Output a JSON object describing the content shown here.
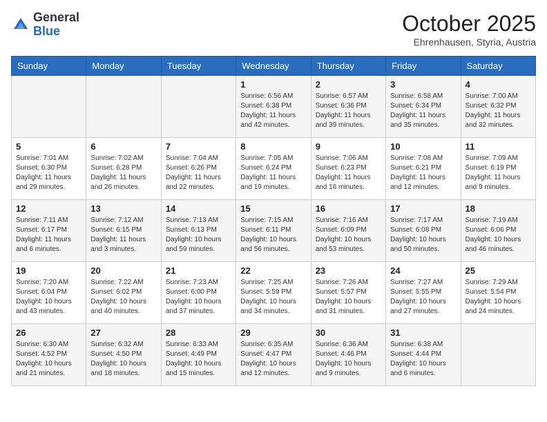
{
  "header": {
    "logo": {
      "general": "General",
      "blue": "Blue"
    },
    "title": "October 2025",
    "location": "Ehrenhausen, Styria, Austria"
  },
  "calendar": {
    "days_of_week": [
      "Sunday",
      "Monday",
      "Tuesday",
      "Wednesday",
      "Thursday",
      "Friday",
      "Saturday"
    ],
    "weeks": [
      [
        {
          "day": "",
          "info": ""
        },
        {
          "day": "",
          "info": ""
        },
        {
          "day": "",
          "info": ""
        },
        {
          "day": "1",
          "info": "Sunrise: 6:56 AM\nSunset: 6:38 PM\nDaylight: 11 hours\nand 42 minutes."
        },
        {
          "day": "2",
          "info": "Sunrise: 6:57 AM\nSunset: 6:36 PM\nDaylight: 11 hours\nand 39 minutes."
        },
        {
          "day": "3",
          "info": "Sunrise: 6:58 AM\nSunset: 6:34 PM\nDaylight: 11 hours\nand 35 minutes."
        },
        {
          "day": "4",
          "info": "Sunrise: 7:00 AM\nSunset: 6:32 PM\nDaylight: 11 hours\nand 32 minutes."
        }
      ],
      [
        {
          "day": "5",
          "info": "Sunrise: 7:01 AM\nSunset: 6:30 PM\nDaylight: 11 hours\nand 29 minutes."
        },
        {
          "day": "6",
          "info": "Sunrise: 7:02 AM\nSunset: 6:28 PM\nDaylight: 11 hours\nand 26 minutes."
        },
        {
          "day": "7",
          "info": "Sunrise: 7:04 AM\nSunset: 6:26 PM\nDaylight: 11 hours\nand 22 minutes."
        },
        {
          "day": "8",
          "info": "Sunrise: 7:05 AM\nSunset: 6:24 PM\nDaylight: 11 hours\nand 19 minutes."
        },
        {
          "day": "9",
          "info": "Sunrise: 7:06 AM\nSunset: 6:23 PM\nDaylight: 11 hours\nand 16 minutes."
        },
        {
          "day": "10",
          "info": "Sunrise: 7:08 AM\nSunset: 6:21 PM\nDaylight: 11 hours\nand 12 minutes."
        },
        {
          "day": "11",
          "info": "Sunrise: 7:09 AM\nSunset: 6:19 PM\nDaylight: 11 hours\nand 9 minutes."
        }
      ],
      [
        {
          "day": "12",
          "info": "Sunrise: 7:11 AM\nSunset: 6:17 PM\nDaylight: 11 hours\nand 6 minutes."
        },
        {
          "day": "13",
          "info": "Sunrise: 7:12 AM\nSunset: 6:15 PM\nDaylight: 11 hours\nand 3 minutes."
        },
        {
          "day": "14",
          "info": "Sunrise: 7:13 AM\nSunset: 6:13 PM\nDaylight: 10 hours\nand 59 minutes."
        },
        {
          "day": "15",
          "info": "Sunrise: 7:15 AM\nSunset: 6:11 PM\nDaylight: 10 hours\nand 56 minutes."
        },
        {
          "day": "16",
          "info": "Sunrise: 7:16 AM\nSunset: 6:09 PM\nDaylight: 10 hours\nand 53 minutes."
        },
        {
          "day": "17",
          "info": "Sunrise: 7:17 AM\nSunset: 6:08 PM\nDaylight: 10 hours\nand 50 minutes."
        },
        {
          "day": "18",
          "info": "Sunrise: 7:19 AM\nSunset: 6:06 PM\nDaylight: 10 hours\nand 46 minutes."
        }
      ],
      [
        {
          "day": "19",
          "info": "Sunrise: 7:20 AM\nSunset: 6:04 PM\nDaylight: 10 hours\nand 43 minutes."
        },
        {
          "day": "20",
          "info": "Sunrise: 7:22 AM\nSunset: 6:02 PM\nDaylight: 10 hours\nand 40 minutes."
        },
        {
          "day": "21",
          "info": "Sunrise: 7:23 AM\nSunset: 6:00 PM\nDaylight: 10 hours\nand 37 minutes."
        },
        {
          "day": "22",
          "info": "Sunrise: 7:25 AM\nSunset: 5:59 PM\nDaylight: 10 hours\nand 34 minutes."
        },
        {
          "day": "23",
          "info": "Sunrise: 7:26 AM\nSunset: 5:57 PM\nDaylight: 10 hours\nand 31 minutes."
        },
        {
          "day": "24",
          "info": "Sunrise: 7:27 AM\nSunset: 5:55 PM\nDaylight: 10 hours\nand 27 minutes."
        },
        {
          "day": "25",
          "info": "Sunrise: 7:29 AM\nSunset: 5:54 PM\nDaylight: 10 hours\nand 24 minutes."
        }
      ],
      [
        {
          "day": "26",
          "info": "Sunrise: 6:30 AM\nSunset: 4:52 PM\nDaylight: 10 hours\nand 21 minutes."
        },
        {
          "day": "27",
          "info": "Sunrise: 6:32 AM\nSunset: 4:50 PM\nDaylight: 10 hours\nand 18 minutes."
        },
        {
          "day": "28",
          "info": "Sunrise: 6:33 AM\nSunset: 4:49 PM\nDaylight: 10 hours\nand 15 minutes."
        },
        {
          "day": "29",
          "info": "Sunrise: 6:35 AM\nSunset: 4:47 PM\nDaylight: 10 hours\nand 12 minutes."
        },
        {
          "day": "30",
          "info": "Sunrise: 6:36 AM\nSunset: 4:46 PM\nDaylight: 10 hours\nand 9 minutes."
        },
        {
          "day": "31",
          "info": "Sunrise: 6:38 AM\nSunset: 4:44 PM\nDaylight: 10 hours\nand 6 minutes."
        },
        {
          "day": "",
          "info": ""
        }
      ]
    ]
  }
}
